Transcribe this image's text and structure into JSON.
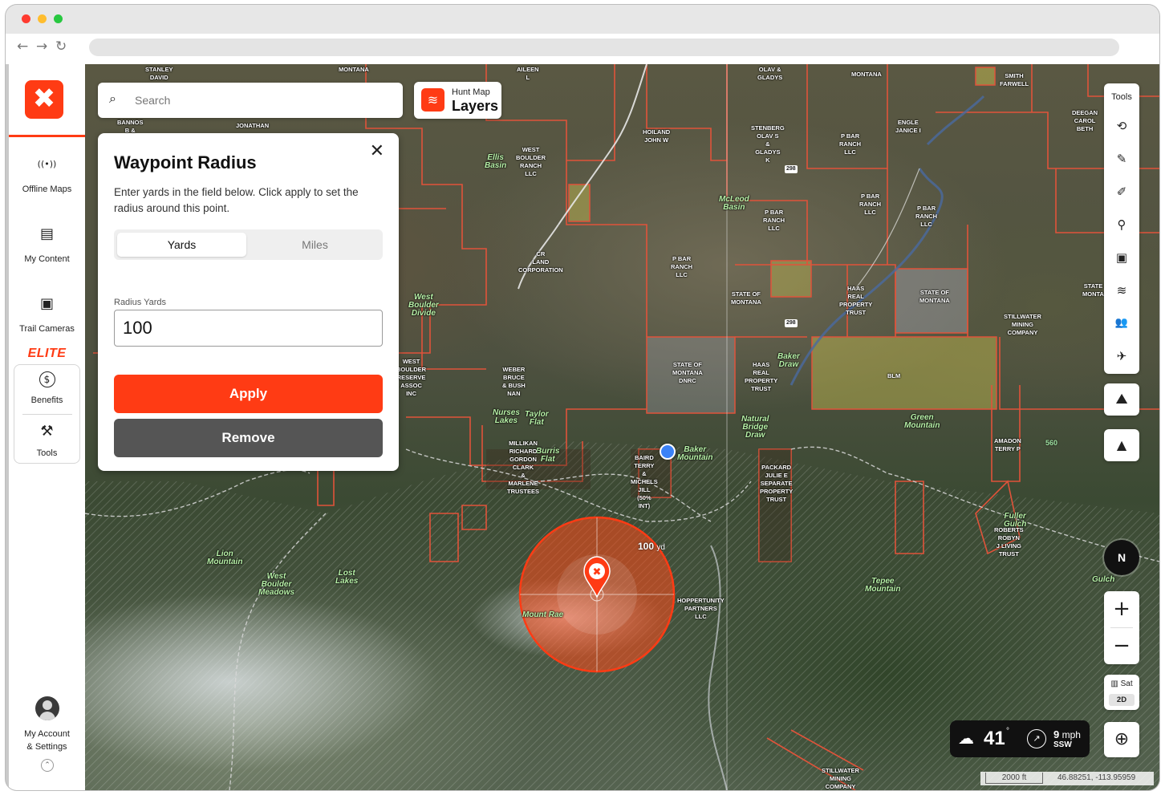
{
  "sidebar": {
    "logo_glyph": "✖",
    "items": [
      {
        "label": "Offline Maps",
        "icon": "offline-maps-icon",
        "glyph": "((•))"
      },
      {
        "label": "My Content",
        "icon": "my-content-icon",
        "glyph": "▤"
      },
      {
        "label": "Trail Cameras",
        "icon": "trail-camera-icon",
        "glyph": "▣"
      }
    ],
    "elite_label": "ELITE",
    "box_items": [
      {
        "label": "Benefits",
        "icon": "dollar-icon",
        "glyph": "$"
      },
      {
        "label": "Tools",
        "icon": "tools-icon",
        "glyph": "⚒"
      }
    ],
    "account_label_line1": "My Account",
    "account_label_line2": "& Settings",
    "collapse_glyph": "⌃"
  },
  "search": {
    "placeholder": "Search"
  },
  "layers": {
    "sub": "Hunt Map",
    "label": "Layers"
  },
  "panel": {
    "title": "Waypoint Radius",
    "description": "Enter yards in the field below. Click apply to set the radius around this point.",
    "unit_yards": "Yards",
    "unit_miles": "Miles",
    "field_label": "Radius Yards",
    "field_value": "100",
    "apply_label": "Apply",
    "remove_label": "Remove",
    "close_glyph": "✕"
  },
  "tools": {
    "title": "Tools",
    "items": [
      {
        "icon": "lasso-icon",
        "glyph": "⟲"
      },
      {
        "icon": "draw-line-icon",
        "glyph": "✎"
      },
      {
        "icon": "draw-shape-icon",
        "glyph": "✐"
      },
      {
        "icon": "waypoint-pin-icon",
        "glyph": "⚲"
      },
      {
        "icon": "trail-cam-tool-icon",
        "glyph": "▣"
      },
      {
        "icon": "wind-icon",
        "glyph": "≋"
      },
      {
        "icon": "people-icon",
        "glyph": "👥"
      },
      {
        "icon": "satellite-icon",
        "glyph": "✈"
      }
    ]
  },
  "map_buttons": {
    "terrain_3d_glyph": "⛰",
    "mountain_glyph": "▲",
    "compass_label": "N",
    "zoom_in": "+",
    "zoom_out": "−",
    "basemap_label": "Sat",
    "basemap_mode": "2D",
    "locate_glyph": "⊕"
  },
  "weather": {
    "icon_glyph": "☁",
    "temp": "41",
    "deg": "°",
    "wind_glyph": "↗",
    "wind_speed": "9",
    "wind_unit": "mph",
    "wind_dir": "SSW"
  },
  "scale": {
    "label": "2000 ft",
    "coords": "46.88251, -113.95959"
  },
  "waypoint": {
    "radius_value": "100",
    "radius_unit": "yd",
    "marker_glyph": "✖"
  },
  "map_labels": [
    {
      "text": "STANLEY\nDAVID",
      "kind": "owner"
    },
    {
      "text": "MONTANA",
      "kind": "owner"
    },
    {
      "text": "AILEEN\nL",
      "kind": "owner"
    },
    {
      "text": "OLAV &\nGLADYS",
      "kind": "owner"
    },
    {
      "text": "MONTANA",
      "kind": "owner"
    },
    {
      "text": "SMITH\nFARWELL",
      "kind": "owner"
    },
    {
      "text": "DEEGAN\nCAROL\nBETH",
      "kind": "owner"
    },
    {
      "text": "ENGLE\nJANICE I",
      "kind": "owner"
    },
    {
      "text": "BANNOS\nB &",
      "kind": "owner"
    },
    {
      "text": "JONATHAN",
      "kind": "owner"
    },
    {
      "text": "HOILAND\nJOHN W",
      "kind": "owner"
    },
    {
      "text": "STENBERG\nOLAV S\n&\nGLADYS\nK",
      "kind": "owner"
    },
    {
      "text": "P BAR\nRANCH\nLLC",
      "kind": "owner"
    },
    {
      "text": "WEST\nBOULDER\nRANCH\nLLC",
      "kind": "owner"
    },
    {
      "text": "Ellis\nBasin",
      "kind": "place"
    },
    {
      "text": "McLeod\nBasin",
      "kind": "place"
    },
    {
      "text": "P BAR\nRANCH\nLLC",
      "kind": "owner"
    },
    {
      "text": "P BAR\nRANCH\nLLC",
      "kind": "owner"
    },
    {
      "text": "P BAR\nRANCH\nLLC",
      "kind": "owner"
    },
    {
      "text": "CR\nLAND\nCORPORATION",
      "kind": "owner"
    },
    {
      "text": "P BAR\nRANCH\nLLC",
      "kind": "owner"
    },
    {
      "text": "STATE OF\nMONTANA",
      "kind": "owner"
    },
    {
      "text": "HAAS\nREAL\nPROPERTY\nTRUST",
      "kind": "owner"
    },
    {
      "text": "STATE OF\nMONTANA",
      "kind": "owner"
    },
    {
      "text": "STATE\nMONTA",
      "kind": "owner"
    },
    {
      "text": "STILLWATER\nMINING\nCOMPANY",
      "kind": "owner"
    },
    {
      "text": "West\nBoulder\nDivide",
      "kind": "place"
    },
    {
      "text": "WEST\nBOULDER\nRESERVE\nASSOC\nINC",
      "kind": "owner"
    },
    {
      "text": "WEBER\nBRUCE\n& BUSH\nNAN",
      "kind": "owner"
    },
    {
      "text": "STATE OF\nMONTANA\nDNRC",
      "kind": "owner"
    },
    {
      "text": "HAAS\nREAL\nPROPERTY\nTRUST",
      "kind": "owner"
    },
    {
      "text": "Baker\nDraw",
      "kind": "place"
    },
    {
      "text": "BLM",
      "kind": "owner"
    },
    {
      "text": "Green\nMountain",
      "kind": "place"
    },
    {
      "text": "Nurses\nLakes",
      "kind": "place"
    },
    {
      "text": "Taylor\nFlat",
      "kind": "place"
    },
    {
      "text": "Burris\nFlat",
      "kind": "place"
    },
    {
      "text": "MILLIKAN\nRICHARD\nGORDON\nCLARK\n&\nMARLENE\nTRUSTEES",
      "kind": "owner"
    },
    {
      "text": "BAIRD\nTERRY\n&\nMICHELS\nJILL\n(50%\nINT)",
      "kind": "owner"
    },
    {
      "text": "Baker\nMountain",
      "kind": "place"
    },
    {
      "text": "Natural\nBridge\nDraw",
      "kind": "place"
    },
    {
      "text": "PACKARD\nJULIE E\nSEPARATE\nPROPERTY\nTRUST",
      "kind": "owner"
    },
    {
      "text": "AMADON\nTERRY P",
      "kind": "owner"
    },
    {
      "text": "560",
      "kind": "road"
    },
    {
      "text": "Lion\nMountain",
      "kind": "place"
    },
    {
      "text": "West\nBoulder\nMeadows",
      "kind": "place"
    },
    {
      "text": "Lost\nLakes",
      "kind": "place"
    },
    {
      "text": "Mount Rae",
      "kind": "place"
    },
    {
      "text": "HOPPERTUNITY\nPARTNERS\nLLC",
      "kind": "owner"
    },
    {
      "text": "Tepee\nMountain",
      "kind": "place"
    },
    {
      "text": "ROBERTS\nROBYN\nJ LIVING\nTRUST",
      "kind": "owner"
    },
    {
      "text": "Fuller\nGulch",
      "kind": "place"
    },
    {
      "text": "Gulch",
      "kind": "place"
    },
    {
      "text": "STILLWATER\nMINING\nCOMPANY",
      "kind": "owner"
    },
    {
      "text": "298",
      "kind": "road"
    },
    {
      "text": "298",
      "kind": "road"
    }
  ],
  "colors": {
    "brand": "#ff3b14",
    "parcel_line": "#e0533a",
    "radius_fill": "#ff4a1a"
  }
}
